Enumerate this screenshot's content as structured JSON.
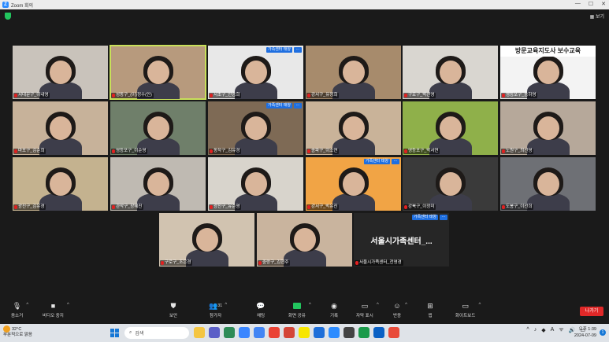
{
  "window": {
    "title": "Zoom 회의",
    "view_label": "보기"
  },
  "banner": {
    "line1": "방문교육지도사 보수교육"
  },
  "tiles": [
    {
      "name": "서대문구_이내영",
      "bg": "#c9c3bb"
    },
    {
      "name": "성동구_(이)정수(인)",
      "bg": "#b79a7d",
      "active": true
    },
    {
      "name": "서초구_안승희",
      "bg": "#e8e8e8",
      "badge": "가족센터 태양"
    },
    {
      "name": "강서구_유정희",
      "bg": "#a78b6c"
    },
    {
      "name": "구로구_박선영",
      "bg": "#d9d6d0"
    },
    {
      "name": "영등포구_송하영",
      "bg": "#f3f3f3"
    },
    {
      "name": "마포구_김순희",
      "bg": "#c7b29a"
    },
    {
      "name": "영등포구_이순영",
      "bg": "#6f7f6a"
    },
    {
      "name": "동작구_김유경",
      "bg": "#7e6a55",
      "badge": "가족센터 태양"
    },
    {
      "name": "송파구_이소연",
      "bg": "#c9b399"
    },
    {
      "name": "영등포구_박서연",
      "bg": "#8fb04a"
    },
    {
      "name": "노원구_최선영",
      "bg": "#b6a89a"
    },
    {
      "name": "광진구_김유경",
      "bg": "#c4b28f"
    },
    {
      "name": "관악구_장혜진",
      "bg": "#bfbab2"
    },
    {
      "name": "광진구_유순영",
      "bg": "#d8d4cc"
    },
    {
      "name": "강서구_박유진",
      "bg": "#f1a445",
      "badge": "가족센터 태양"
    },
    {
      "name": "강북구_이정미",
      "bg": "#3a3a3a"
    },
    {
      "name": "도봉구_이선희",
      "bg": "#6e7075"
    },
    {
      "name": "구로구_조은경",
      "bg": "#d1c3b0"
    },
    {
      "name": "중랑구_김현주",
      "bg": "#c9b49e"
    },
    {
      "name": "서울시가족센터_전영경",
      "bg": "#262626",
      "text": "서울시가족센터_...",
      "badge": "가족센터 태양"
    }
  ],
  "toolbar": {
    "audio": "음소거",
    "video": "비디오 중지",
    "security": "보안",
    "participants": "참가자",
    "participants_count": "31",
    "chat": "채팅",
    "share": "화면 공유",
    "record": "기록",
    "captions": "자막 표시",
    "reactions": "반응",
    "apps": "앱",
    "whiteboard": "화이트보드",
    "leave": "나가기"
  },
  "taskbar": {
    "weather_temp": "32°C",
    "weather_desc": "부분적으로 맑음",
    "search": "검색",
    "lang": "A",
    "time": "오후 1:39",
    "date": "2024-07-09",
    "notifications": "1"
  },
  "colors": {
    "accent": "#2d8cff",
    "mute": "#e02020",
    "leave": "#e02828",
    "active_outline": "#c8e05a"
  }
}
